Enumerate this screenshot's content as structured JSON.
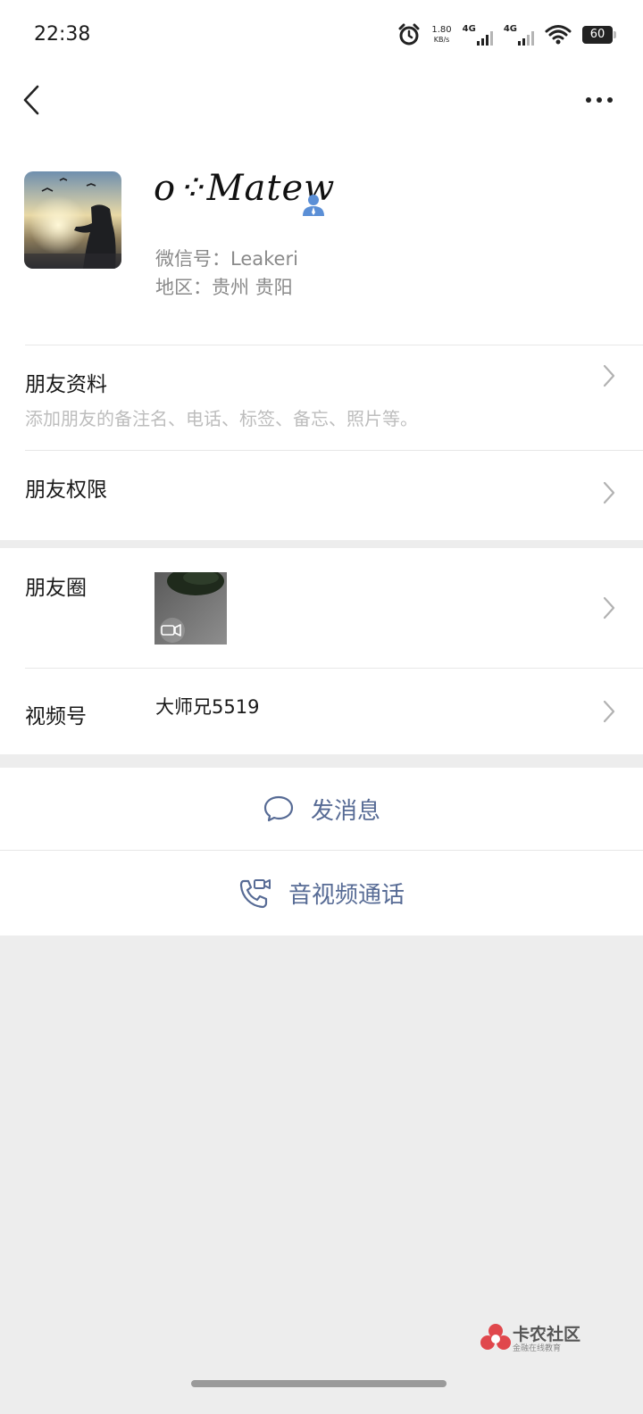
{
  "status_bar": {
    "time": "22:38",
    "net_speed_value": "1.80",
    "net_speed_unit": "KB/s",
    "sim1_label": "4G",
    "sim2_label": "4G",
    "battery": "60"
  },
  "profile": {
    "nickname": "o⁘Matew",
    "wechat_id": "微信号：Leakeri",
    "region": "地区：贵州  贵阳"
  },
  "rows": {
    "friend_info_title": "朋友资料",
    "friend_info_sub": "添加朋友的备注名、电话、标签、备忘、照片等。",
    "friend_permission_title": "朋友权限",
    "moments_title": "朋友圈",
    "channels_title": "视频号",
    "channels_value": "大师兄5519"
  },
  "actions": {
    "send_message": "发消息",
    "av_call": "音视频通话"
  },
  "watermark": {
    "title": "卡农社区",
    "sub": "金融在线教育"
  },
  "colors": {
    "link_blue": "#576b95",
    "background": "#ededed",
    "watermark_red": "#e0474c"
  }
}
